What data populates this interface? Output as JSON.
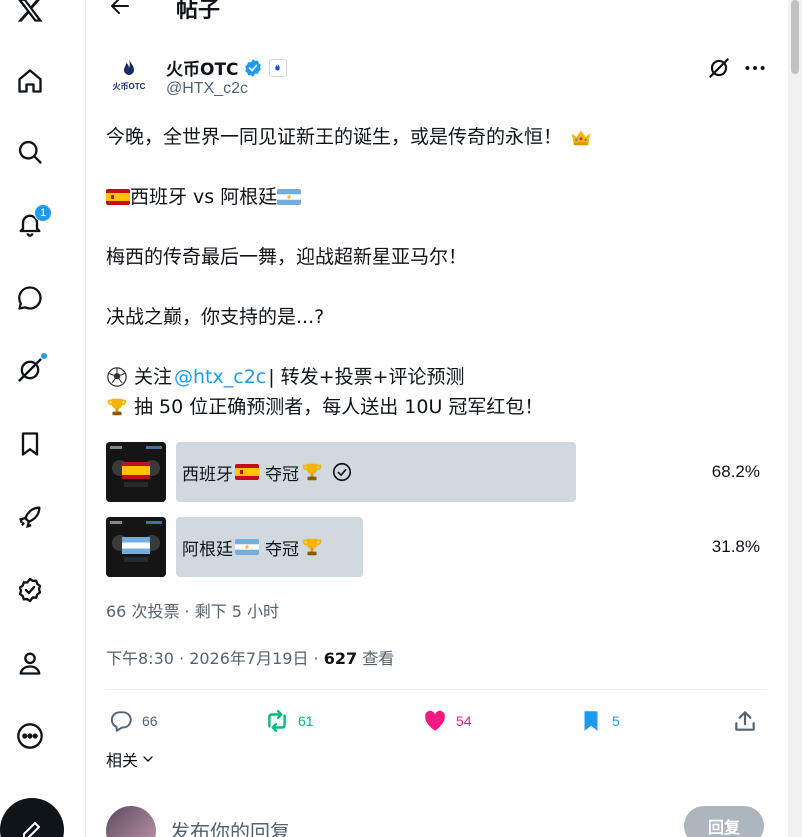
{
  "header": {
    "title": "帖子"
  },
  "nav": {
    "notifications_badge": "1"
  },
  "author": {
    "display_name": "火币OTC",
    "handle": "@HTX_c2c",
    "avatar_text": "火币OTC"
  },
  "tweet": {
    "line1": "今晚，全世界一同见证新王的诞生，或是传奇的永恒！",
    "line2_left": "西班牙 vs 阿根廷",
    "line3": "梅西的传奇最后一舞，迎战超新星亚马尔！",
    "line4": "决战之巅，你支持的是...?",
    "line5_prefix": "关注",
    "line5_mention": "@htx_c2c",
    "line5_suffix": "| 转发+投票+评论预测",
    "line6": "抽 50 位正确预测者，每人送出 10U 冠军红包！"
  },
  "poll": {
    "options": [
      {
        "label_a": "西班牙",
        "label_b": "夺冠",
        "percent": "68.2%",
        "share": 0.682,
        "selected": true
      },
      {
        "label_a": "阿根廷",
        "label_b": "夺冠",
        "percent": "31.8%",
        "share": 0.318,
        "selected": false
      }
    ],
    "meta": "66 次投票 · 剩下 5 小时"
  },
  "timestamp": {
    "time": "下午8:30 · 2026年7月19日 · ",
    "views": "627",
    "views_label": " 查看"
  },
  "actions": {
    "replies": "66",
    "reposts": "61",
    "likes": "54",
    "bookmarks": "5"
  },
  "related": {
    "label": "相关"
  },
  "reply": {
    "placeholder": "发布你的回复",
    "button": "回复"
  },
  "colors": {
    "accent": "#1d9bf0",
    "repost": "#00ba7c",
    "like": "#f91880",
    "bar": "#cfd9de"
  }
}
